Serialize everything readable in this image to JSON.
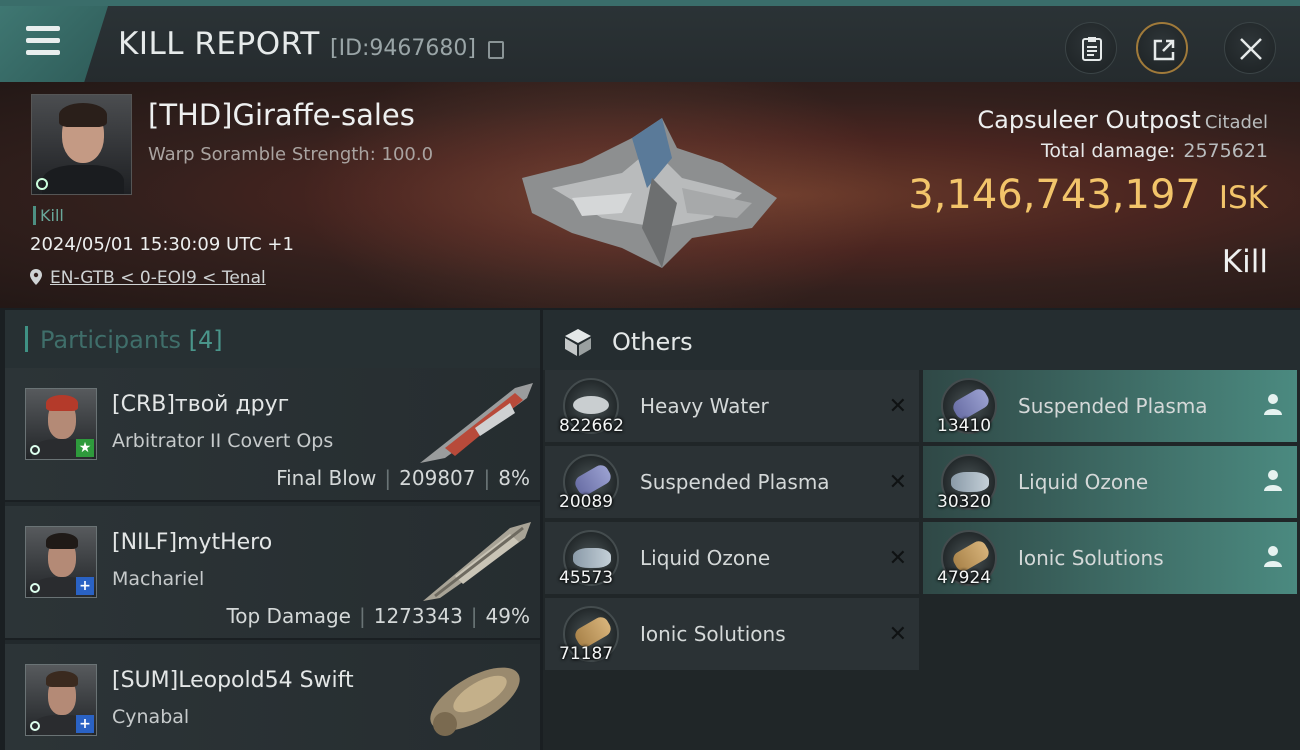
{
  "header": {
    "title": "KILL REPORT",
    "report_id": "[ID:9467680]"
  },
  "victim": {
    "name": "[THD]Giraffe-sales",
    "warp": "Warp Soramble Strength: 100.0",
    "kill_tag": "Kill",
    "datetime": "2024/05/01 15:30:09 UTC +1",
    "location": "EN-GTB < 0-EOI9 < Tenal"
  },
  "target": {
    "name": "Capsuleer Outpost",
    "type": "Citadel",
    "total_damage_label": "Total damage:",
    "total_damage": "2575621",
    "isk_value": "3,146,743,197",
    "isk_unit": "ISK",
    "result": "Kill"
  },
  "participants": {
    "label": "Participants",
    "count": "[4]",
    "rows": [
      {
        "name": "[CRB]твой друг",
        "ship": "Arbitrator II Covert Ops",
        "role": "Final Blow",
        "damage": "209807",
        "percent": "8%"
      },
      {
        "name": "[NILF]mytHero",
        "ship": "Machariel",
        "role": "Top Damage",
        "damage": "1273343",
        "percent": "49%"
      },
      {
        "name": "[SUM]Leopold54 Swift",
        "ship": "Cynabal",
        "role": "",
        "damage": "",
        "percent": ""
      }
    ]
  },
  "others": {
    "label": "Others",
    "destroyed": [
      {
        "name": "Heavy Water",
        "qty": "822662"
      },
      {
        "name": "Suspended Plasma",
        "qty": "20089"
      },
      {
        "name": "Liquid Ozone",
        "qty": "45573"
      },
      {
        "name": "Ionic Solutions",
        "qty": "71187"
      }
    ],
    "dropped": [
      {
        "name": "Suspended Plasma",
        "qty": "13410"
      },
      {
        "name": "Liquid Ozone",
        "qty": "30320"
      },
      {
        "name": "Ionic Solutions",
        "qty": "47924"
      }
    ]
  },
  "colors": {
    "accent": "#3f9184",
    "isk": "#f2c46a",
    "banner": "#4a2520"
  },
  "icons": [
    "menu-icon",
    "copy-icon",
    "clipboard-icon",
    "share-icon",
    "close-icon",
    "pin-icon",
    "cube-icon",
    "person-icon",
    "remove-icon"
  ]
}
